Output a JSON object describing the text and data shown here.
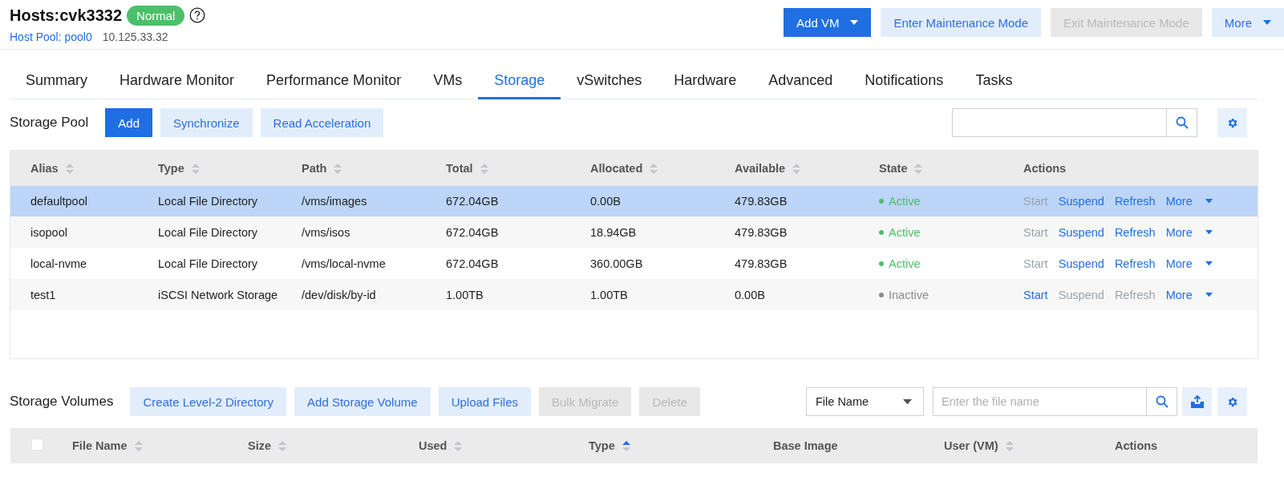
{
  "header": {
    "title": "Hosts:cvk3332",
    "status": "Normal",
    "host_pool": "Host Pool: pool0",
    "ip": "10.125.33.32"
  },
  "header_buttons": [
    {
      "label": "Add VM",
      "primary": true,
      "disabled": false,
      "caret": true
    },
    {
      "label": "Enter Maintenance Mode",
      "primary": false,
      "disabled": false,
      "caret": false
    },
    {
      "label": "Exit Maintenance Mode",
      "primary": false,
      "disabled": true,
      "caret": false
    },
    {
      "label": "More",
      "primary": false,
      "disabled": false,
      "caret": true
    }
  ],
  "tabs": [
    {
      "label": "Summary",
      "selected": false
    },
    {
      "label": "Hardware Monitor",
      "selected": false
    },
    {
      "label": "Performance Monitor",
      "selected": false
    },
    {
      "label": "VMs",
      "selected": false
    },
    {
      "label": "Storage",
      "selected": true
    },
    {
      "label": "vSwitches",
      "selected": false
    },
    {
      "label": "Hardware",
      "selected": false
    },
    {
      "label": "Advanced",
      "selected": false
    },
    {
      "label": "Notifications",
      "selected": false
    },
    {
      "label": "Tasks",
      "selected": false
    }
  ],
  "storage_pool": {
    "title": "Storage Pool",
    "buttons": [
      {
        "label": "Add",
        "primary": true,
        "disabled": false
      },
      {
        "label": "Synchronize",
        "primary": false,
        "disabled": false
      },
      {
        "label": "Read Acceleration",
        "primary": false,
        "disabled": false
      }
    ],
    "columns": [
      {
        "label": "Alias",
        "sortable": true,
        "sorted": false
      },
      {
        "label": "Type",
        "sortable": true,
        "sorted": false
      },
      {
        "label": "Path",
        "sortable": true,
        "sorted": false
      },
      {
        "label": "Total",
        "sortable": true,
        "sorted": false
      },
      {
        "label": "Allocated",
        "sortable": true,
        "sorted": false
      },
      {
        "label": "Available",
        "sortable": true,
        "sorted": false
      },
      {
        "label": "State",
        "sortable": true,
        "sorted": false
      },
      {
        "label": "Actions",
        "sortable": false,
        "sorted": false
      }
    ],
    "rows": [
      {
        "selected": true,
        "alias": "defaultpool",
        "type": "Local File Directory",
        "path": "/vms/images",
        "total": "672.04GB",
        "allocated": "0.00B",
        "available": "479.83GB",
        "state": {
          "label": "Active",
          "color": "#4cbf6b"
        },
        "actions": [
          {
            "label": "Start",
            "enabled": false,
            "caret": false
          },
          {
            "label": "Suspend",
            "enabled": true,
            "caret": false
          },
          {
            "label": "Refresh",
            "enabled": true,
            "caret": false
          },
          {
            "label": "More",
            "enabled": true,
            "caret": true
          }
        ]
      },
      {
        "selected": false,
        "alias": "isopool",
        "type": "Local File Directory",
        "path": "/vms/isos",
        "total": "672.04GB",
        "allocated": "18.94GB",
        "available": "479.83GB",
        "state": {
          "label": "Active",
          "color": "#4cbf6b"
        },
        "actions": [
          {
            "label": "Start",
            "enabled": false,
            "caret": false
          },
          {
            "label": "Suspend",
            "enabled": true,
            "caret": false
          },
          {
            "label": "Refresh",
            "enabled": true,
            "caret": false
          },
          {
            "label": "More",
            "enabled": true,
            "caret": true
          }
        ]
      },
      {
        "selected": false,
        "alias": "local-nvme",
        "type": "Local File Directory",
        "path": "/vms/local-nvme",
        "total": "672.04GB",
        "allocated": "360.00GB",
        "available": "479.83GB",
        "state": {
          "label": "Active",
          "color": "#4cbf6b"
        },
        "actions": [
          {
            "label": "Start",
            "enabled": false,
            "caret": false
          },
          {
            "label": "Suspend",
            "enabled": true,
            "caret": false
          },
          {
            "label": "Refresh",
            "enabled": true,
            "caret": false
          },
          {
            "label": "More",
            "enabled": true,
            "caret": true
          }
        ]
      },
      {
        "selected": false,
        "alias": "test1",
        "type": "iSCSI Network Storage",
        "path": "/dev/disk/by-id",
        "total": "1.00TB",
        "allocated": "1.00TB",
        "available": "0.00B",
        "state": {
          "label": "Inactive",
          "color": "#8c8c8c"
        },
        "actions": [
          {
            "label": "Start",
            "enabled": true,
            "caret": false
          },
          {
            "label": "Suspend",
            "enabled": false,
            "caret": false
          },
          {
            "label": "Refresh",
            "enabled": false,
            "caret": false
          },
          {
            "label": "More",
            "enabled": true,
            "caret": true
          }
        ]
      }
    ]
  },
  "storage_volumes": {
    "title": "Storage Volumes",
    "buttons": [
      {
        "label": "Create Level-2 Directory",
        "primary": false,
        "disabled": false
      },
      {
        "label": "Add Storage Volume",
        "primary": false,
        "disabled": false
      },
      {
        "label": "Upload Files",
        "primary": false,
        "disabled": false
      },
      {
        "label": "Bulk Migrate",
        "primary": false,
        "disabled": true
      },
      {
        "label": "Delete",
        "primary": false,
        "disabled": true
      }
    ],
    "filter": "File Name",
    "search": {
      "placeholder": "Enter the file name"
    },
    "select_all": {
      "checked": false
    },
    "columns": [
      {
        "label": "File Name",
        "sortable": true,
        "sorted": false
      },
      {
        "label": "Size",
        "sortable": true,
        "sorted": false
      },
      {
        "label": "Used",
        "sortable": true,
        "sorted": false
      },
      {
        "label": "Type",
        "sortable": true,
        "sorted": true
      },
      {
        "label": "Base Image",
        "sortable": false,
        "sorted": false
      },
      {
        "label": "User (VM)",
        "sortable": true,
        "sorted": false
      },
      {
        "label": "Actions",
        "sortable": false,
        "sorted": false
      }
    ]
  }
}
